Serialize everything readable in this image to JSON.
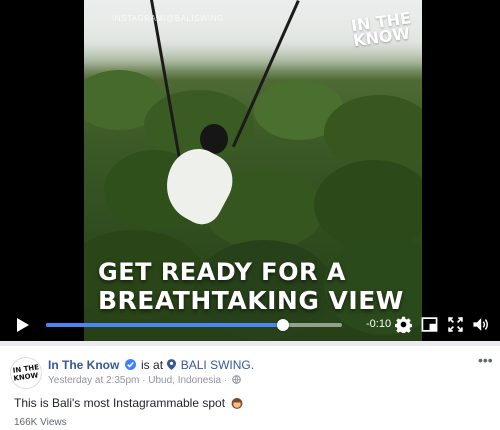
{
  "video": {
    "watermark": "INSTAGRAM/@BALISWING",
    "brand_line1": "IN THE",
    "brand_line2": "KNOW",
    "caption_line1": "GET READY FOR A",
    "caption_line2": "BREATHTAKING VIEW",
    "progress_fraction": 0.8,
    "time_remaining": "-0:10"
  },
  "post": {
    "avatar_line1": "IN THE",
    "avatar_line2": "KNOW",
    "page_name": "In The Know",
    "is_at": "is at",
    "location": "BALI SWING.",
    "timestamp": "Yesterday at 2:35pm · Ubud, Indonesia ·",
    "text": "This is Bali's most Instagrammable spot",
    "views": "166K Views",
    "more": "•••"
  },
  "colors": {
    "accent": "#4a87f5",
    "link": "#365899",
    "verified": "#4080ff"
  }
}
